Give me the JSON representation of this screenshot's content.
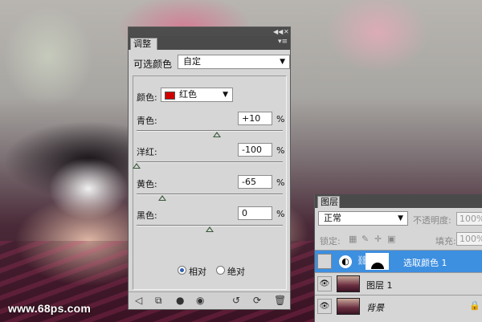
{
  "watermark": "www.68ps.com",
  "colors": {
    "selected_layer": "#3d8fe0",
    "red_swatch": "#d00000",
    "panel_bg": "#d6d6d6",
    "panel_header": "#4a4a4a"
  },
  "adjustments": {
    "collapse_icon": "double-arrow-left-icon",
    "close_icon": "close-icon",
    "tab_label": "调整",
    "preset_label": "可选颜色",
    "preset_value": "自定",
    "colors_label": "颜色:",
    "colors_value": "红色",
    "sliders": [
      {
        "label": "青色:",
        "value": "+10",
        "unit": "%",
        "position": 0.55
      },
      {
        "label": "洋红:",
        "value": "-100",
        "unit": "%",
        "position": 0.0
      },
      {
        "label": "黄色:",
        "value": "-65",
        "unit": "%",
        "position": 0.175
      },
      {
        "label": "黑色:",
        "value": "0",
        "unit": "%",
        "position": 0.5
      }
    ],
    "method": {
      "relative_label": "相对",
      "absolute_label": "绝对",
      "selected": "relative"
    },
    "bottom_icons": [
      "back-arrow-icon",
      "clip-layer-icon",
      "visibility-icon",
      "view-previous-icon",
      "reset-icon",
      "refresh-icon",
      "trash-icon"
    ]
  },
  "layers": {
    "tab_label": "图层",
    "blend_mode": "正常",
    "opacity_label": "不透明度:",
    "opacity_value": "100%",
    "lock_label": "锁定:",
    "fill_label": "填充:",
    "fill_value": "100%",
    "items": [
      {
        "name": "选取颜色 1",
        "selected": true,
        "visible": false
      },
      {
        "name": "图层 1",
        "selected": false,
        "visible": true
      },
      {
        "name": "背景",
        "selected": false,
        "visible": true,
        "locked": true
      }
    ]
  }
}
